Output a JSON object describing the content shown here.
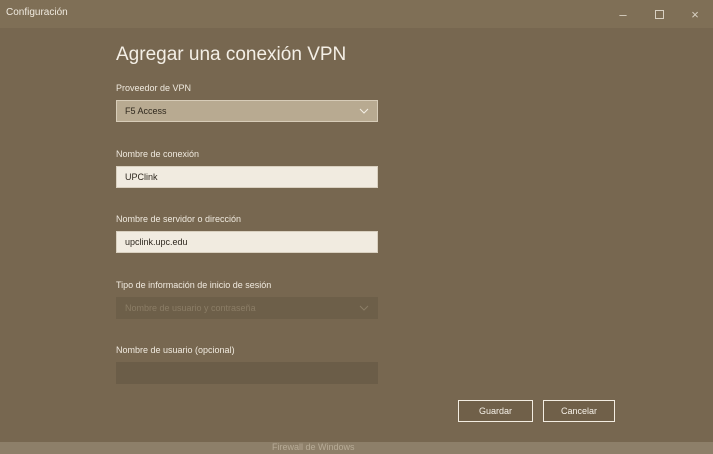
{
  "window": {
    "title": "Configuración",
    "controls": {
      "minimize": "–",
      "close": "×"
    }
  },
  "dialog": {
    "title": "Agregar una conexión VPN",
    "fields": {
      "provider": {
        "label": "Proveedor de VPN",
        "value": "F5 Access"
      },
      "connection_name": {
        "label": "Nombre de conexión",
        "value": "UPClink"
      },
      "server": {
        "label": "Nombre de servidor o dirección",
        "value": "upclink.upc.edu"
      },
      "sign_in_type": {
        "label": "Tipo de información de inicio de sesión",
        "value": "Nombre de usuario y contraseña"
      },
      "username": {
        "label": "Nombre de usuario (opcional)",
        "value": ""
      }
    },
    "buttons": {
      "save": "Guardar",
      "cancel": "Cancelar"
    }
  },
  "background": {
    "footer_text": "Firewall de Windows"
  },
  "icons": {
    "dropdown": "chevron-down-icon"
  },
  "colors": {
    "overlay": "#776750",
    "input_active": "#f1ebe0",
    "select_active": "#b8aa91"
  }
}
